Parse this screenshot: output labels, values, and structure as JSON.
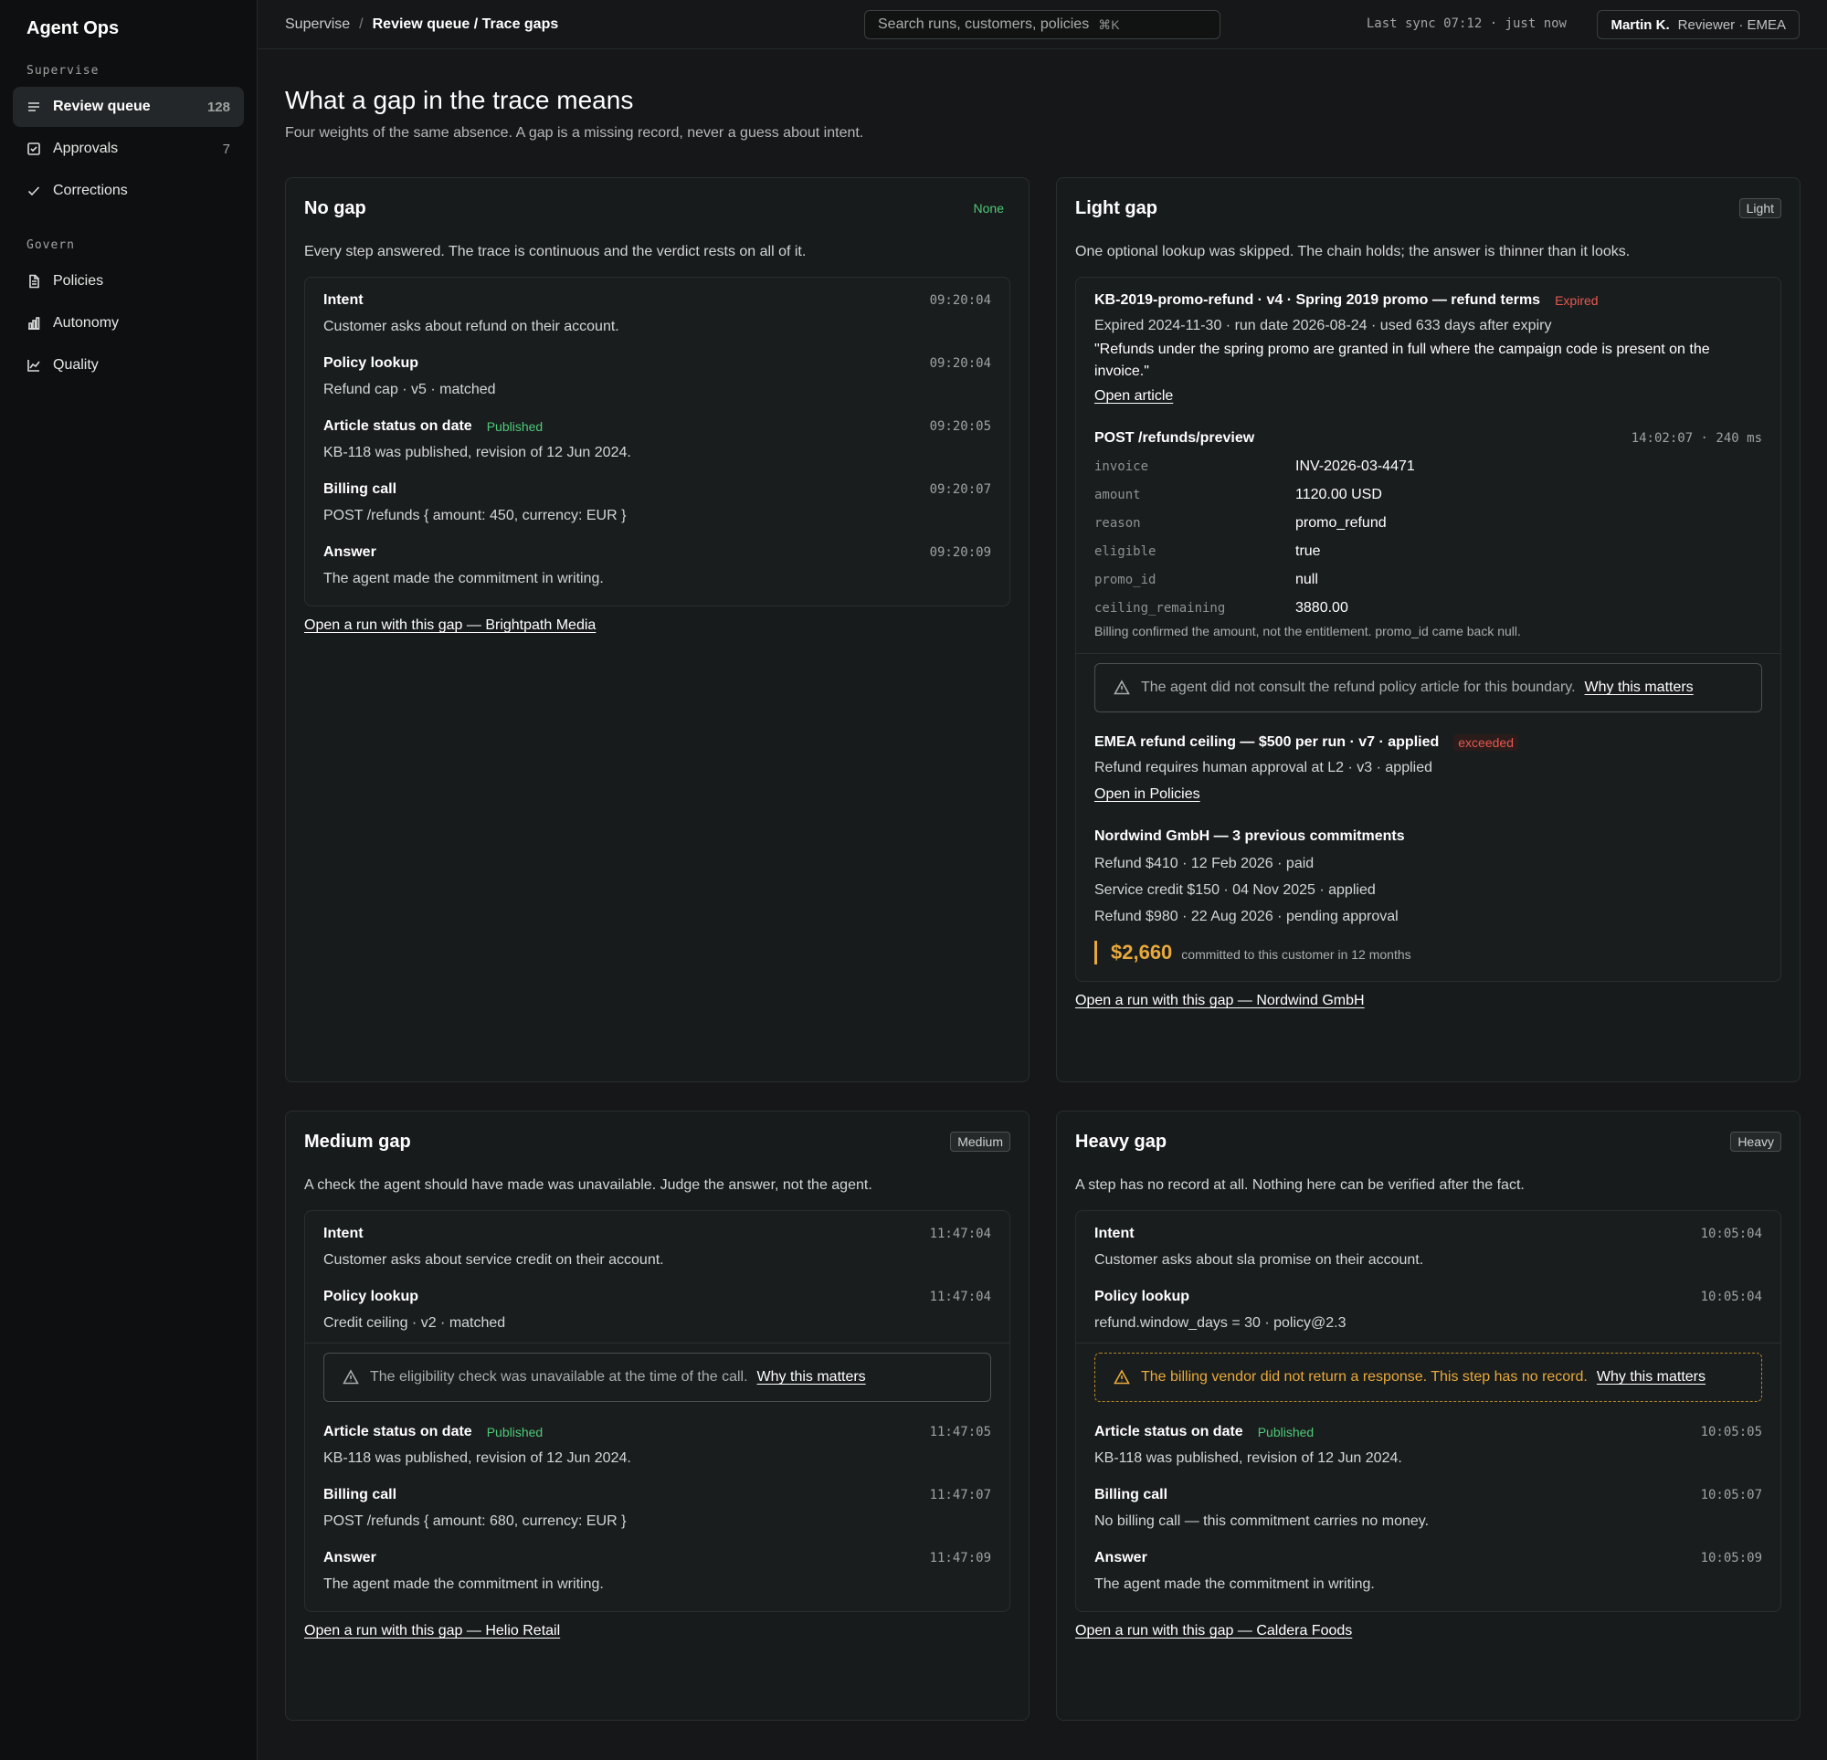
{
  "app": {
    "title": "Agent Ops"
  },
  "sidebar": {
    "sections": [
      {
        "label": "Supervise",
        "items": [
          {
            "label": "Review queue",
            "count": "128",
            "icon": "list-icon"
          },
          {
            "label": "Approvals",
            "count": "7",
            "icon": "checkbox-icon"
          },
          {
            "label": "Corrections",
            "count": "",
            "icon": "check-icon"
          }
        ]
      },
      {
        "label": "Govern",
        "items": [
          {
            "label": "Policies",
            "icon": "document-icon"
          },
          {
            "label": "Autonomy",
            "icon": "bar-chart-icon"
          },
          {
            "label": "Quality",
            "icon": "line-chart-icon"
          }
        ]
      }
    ]
  },
  "topbar": {
    "breadcrumb": {
      "root": "Supervise",
      "separator": "/",
      "current": "Review queue / Trace gaps"
    },
    "search": {
      "placeholder": "Search runs, customers, policies",
      "shortcut": "⌘K"
    },
    "sync": "Last sync 07:12 · just now",
    "user": {
      "name": "Martin K.",
      "role": "Reviewer · EMEA"
    }
  },
  "page": {
    "title": "What a gap in the trace means",
    "subtitle": "Four weights of the same absence. A gap is a missing record, never a guess about intent."
  },
  "cards": {
    "none": {
      "title": "No gap",
      "badge": "None",
      "desc": "Every step answered. The trace is continuous and the verdict rests on all of it.",
      "steps": [
        {
          "title": "Intent",
          "time": "09:20:04",
          "body": "Customer asks about refund on their account."
        },
        {
          "title": "Policy lookup",
          "time": "09:20:04",
          "body": "Refund cap · v5 · matched"
        },
        {
          "title": "Article status on date",
          "tag": "Published",
          "time": "09:20:05",
          "body": "KB-118 was published, revision of 12 Jun 2024."
        },
        {
          "title": "Billing call",
          "time": "09:20:07",
          "body": "POST /refunds { amount: 450, currency: EUR }"
        },
        {
          "title": "Answer",
          "time": "09:20:09",
          "body": "The agent made the commitment in writing."
        }
      ],
      "link": "Open a run with this gap — Brightpath Media"
    },
    "light": {
      "title": "Light gap",
      "badge": "Light",
      "desc": "One optional lookup was skipped. The chain holds; the answer is thinner than it looks.",
      "article": {
        "title": "KB-2019-promo-refund · v4 · Spring 2019 promo — refund terms",
        "tag": "Expired",
        "meta": "Expired 2024-11-30 · run date 2026-08-24 · used 633 days after expiry",
        "quote": "\"Refunds under the spring promo are granted in full where the campaign code is present on the invoice.\"",
        "link": "Open article"
      },
      "request": {
        "title": "POST /refunds/preview",
        "time": "14:02:07 · 240 ms",
        "fields": [
          {
            "k": "invoice",
            "v": "INV-2026-03-4471"
          },
          {
            "k": "amount",
            "v": "1120.00 USD"
          },
          {
            "k": "reason",
            "v": "promo_refund"
          },
          {
            "k": "eligible",
            "v": "true"
          },
          {
            "k": "promo_id",
            "v": "null"
          },
          {
            "k": "ceiling_remaining",
            "v": "3880.00"
          }
        ],
        "note": "Billing confirmed the amount, not the entitlement. promo_id came back null."
      },
      "warning": {
        "text": "The agent did not consult the refund policy article for this boundary.",
        "why": "Why this matters"
      },
      "policy": {
        "title": "EMEA refund ceiling — $500 per run · v7 · applied",
        "tag": "exceeded",
        "line": "Refund requires human approval at L2 · v3 · applied",
        "link": "Open in Policies"
      },
      "history": {
        "title": "Nordwind GmbH — 3 previous commitments",
        "lines": [
          "Refund $410 · 12 Feb 2026 · paid",
          "Service credit $150 · 04 Nov 2025 · applied",
          "Refund $980 · 22 Aug 2026 · pending approval"
        ],
        "total": "$2,660",
        "total_caption": "committed to this customer in 12 months"
      },
      "link": "Open a run with this gap — Nordwind GmbH"
    },
    "medium": {
      "title": "Medium gap",
      "badge": "Medium",
      "desc": "A check the agent should have made was unavailable. Judge the answer, not the agent.",
      "steps_before": [
        {
          "title": "Intent",
          "time": "11:47:04",
          "body": "Customer asks about service credit on their account."
        },
        {
          "title": "Policy lookup",
          "time": "11:47:04",
          "body": "Credit ceiling · v2 · matched"
        }
      ],
      "warning": {
        "text": "The eligibility check was unavailable at the time of the call.",
        "why": "Why this matters"
      },
      "steps_after": [
        {
          "title": "Article status on date",
          "tag": "Published",
          "time": "11:47:05",
          "body": "KB-118 was published, revision of 12 Jun 2024."
        },
        {
          "title": "Billing call",
          "time": "11:47:07",
          "body": "POST /refunds { amount: 680, currency: EUR }"
        },
        {
          "title": "Answer",
          "time": "11:47:09",
          "body": "The agent made the commitment in writing."
        }
      ],
      "link": "Open a run with this gap — Helio Retail"
    },
    "heavy": {
      "title": "Heavy gap",
      "badge": "Heavy",
      "desc": "A step has no record at all. Nothing here can be verified after the fact.",
      "steps_before": [
        {
          "title": "Intent",
          "time": "10:05:04",
          "body": "Customer asks about sla promise on their account."
        },
        {
          "title": "Policy lookup",
          "time": "10:05:04",
          "body": "refund.window_days = 30 · policy@2.3"
        }
      ],
      "warning": {
        "text": "The billing vendor did not return a response. This step has no record.",
        "why": "Why this matters"
      },
      "steps_after": [
        {
          "title": "Article status on date",
          "tag": "Published",
          "time": "10:05:05",
          "body": "KB-118 was published, revision of 12 Jun 2024."
        },
        {
          "title": "Billing call",
          "time": "10:05:07",
          "body": "No billing call — this commitment carries no money."
        },
        {
          "title": "Answer",
          "time": "10:05:09",
          "body": "The agent made the commitment in writing."
        }
      ],
      "link": "Open a run with this gap — Caldera Foods"
    }
  }
}
